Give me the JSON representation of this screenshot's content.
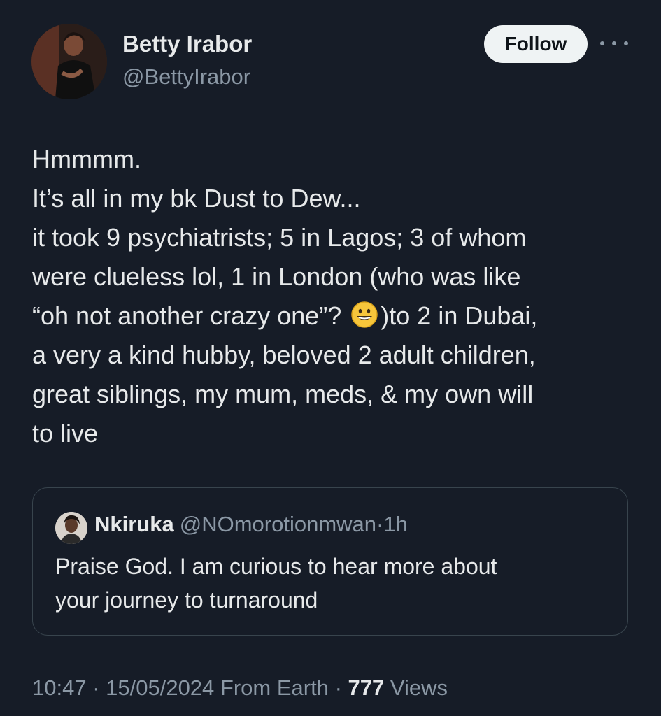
{
  "author": {
    "name": "Betty Irabor",
    "handle": "@BettyIrabor"
  },
  "actions": {
    "follow_label": "Follow",
    "more_icon": "more-horizontal-icon"
  },
  "tweet": {
    "lines": [
      "Hmmmm.",
      "It’s all in my bk Dust to Dew...",
      "it took 9 psychiatrists; 5 in Lagos; 3 of whom",
      "were clueless lol, 1 in London (who was like",
      "“oh not another  crazy one”? ",
      ")to 2 in Dubai,",
      "a very a kind hubby, beloved 2 adult children,",
      "great siblings, my mum, meds, & my own will",
      "to live"
    ],
    "emoji": "grinning-face-emoji"
  },
  "quote": {
    "name": "Nkiruka",
    "handle": "@NOmorotionmwan",
    "separator": "·",
    "time": "1h",
    "text_lines": [
      "Praise God. I am curious to hear more about",
      "your journey to turnaround"
    ]
  },
  "meta": {
    "time": "10:47",
    "sep1": " · ",
    "date": "15/05/2024",
    "source": " From Earth",
    "sep2": " · ",
    "views_count": "777",
    "views_label": " Views"
  }
}
